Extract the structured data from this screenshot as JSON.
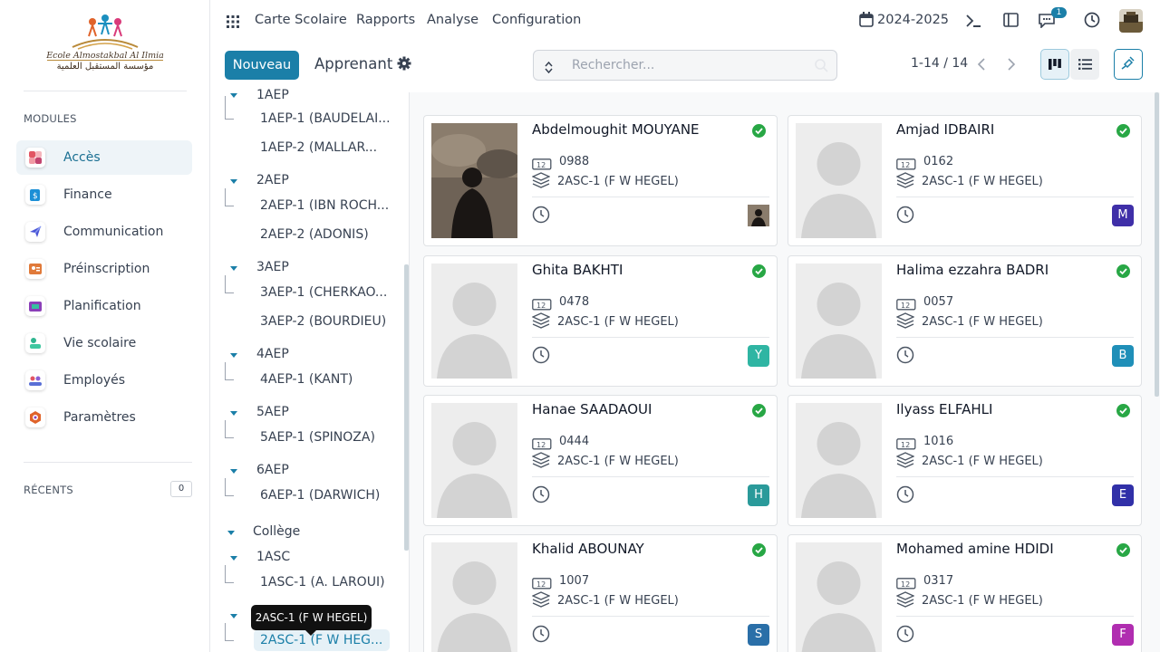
{
  "logo": {
    "line1": "Ecole Almostakbal Al Ilmia",
    "line2": "مؤسسة المستقبل العلمية"
  },
  "sidebar": {
    "modules_heading": "MODULES",
    "modules": [
      {
        "label": "Accès",
        "icon": "access-icon",
        "active": true
      },
      {
        "label": "Finance",
        "icon": "finance-icon"
      },
      {
        "label": "Communication",
        "icon": "communication-icon"
      },
      {
        "label": "Préinscription",
        "icon": "preinscription-icon"
      },
      {
        "label": "Planification",
        "icon": "planification-icon"
      },
      {
        "label": "Vie scolaire",
        "icon": "school-life-icon"
      },
      {
        "label": "Employés",
        "icon": "employees-icon"
      },
      {
        "label": "Paramètres",
        "icon": "settings-icon"
      }
    ],
    "recents_heading": "RÉCENTS",
    "recents_count": "0"
  },
  "topnav": {
    "items": [
      "Carte Scolaire",
      "Rapports",
      "Analyse",
      "Configuration"
    ],
    "year": "2024-2025",
    "chat_badge": "1"
  },
  "controls": {
    "new_label": "Nouveau",
    "title": "Apprenant",
    "search_placeholder": "Rechercher...",
    "pager": "1-14 / 14"
  },
  "tree": {
    "cut_top": "1AEP",
    "leaves_1aep": [
      "1AEP-1 (BAUDELAI...",
      "1AEP-2 (MALLAR..."
    ],
    "levels": [
      "2AEP",
      "3AEP",
      "4AEP",
      "5AEP",
      "6AEP"
    ],
    "leaves": {
      "2AEP": [
        "2AEP-1 (IBN ROCH...",
        "2AEP-2 (ADONIS)"
      ],
      "3AEP": [
        "3AEP-1 (CHERKAO...",
        "3AEP-2 (BOURDIEU)"
      ],
      "4AEP": [
        "4AEP-1 (KANT)"
      ],
      "5AEP": [
        "5AEP-1 (SPINOZA)"
      ],
      "6AEP": [
        "6AEP-1 (DARWICH)"
      ]
    },
    "college": "Collège",
    "asc1": "1ASC",
    "asc1_leaf": "1ASC-1 (A. LAROUI)",
    "tooltip": "2ASC-1 (F W HEGEL)",
    "selected": "2ASC-1 (F W HEG..."
  },
  "students": [
    {
      "name": "Abdelmoughit MOUYANE",
      "id": "0988",
      "class": "2ASC-1 (F W HEGEL)",
      "avatar": "",
      "avatar_color": "#5b4a3a",
      "photo": true
    },
    {
      "name": "Amjad IDBAIRI",
      "id": "0162",
      "class": "2ASC-1 (F W HEGEL)",
      "avatar": "M",
      "avatar_color": "#3f2fa8"
    },
    {
      "name": "Ghita BAKHTI",
      "id": "0478",
      "class": "2ASC-1 (F W HEGEL)",
      "avatar": "Y",
      "avatar_color": "#2fb5a3"
    },
    {
      "name": "Halima ezzahra BADRI",
      "id": "0057",
      "class": "2ASC-1 (F W HEGEL)",
      "avatar": "B",
      "avatar_color": "#1f8fb8"
    },
    {
      "name": "Hanae SAADAOUI",
      "id": "0444",
      "class": "2ASC-1 (F W HEGEL)",
      "avatar": "H",
      "avatar_color": "#2a9a9a"
    },
    {
      "name": "Ilyass ELFAHLI",
      "id": "1016",
      "class": "2ASC-1 (F W HEGEL)",
      "avatar": "E",
      "avatar_color": "#3130a8"
    },
    {
      "name": "Khalid ABOUNAY",
      "id": "1007",
      "class": "2ASC-1 (F W HEGEL)",
      "avatar": "S",
      "avatar_color": "#2a6fa8"
    },
    {
      "name": "Mohamed amine HDIDI",
      "id": "0317",
      "class": "2ASC-1 (F W HEGEL)",
      "avatar": "F",
      "avatar_color": "#b02db0"
    }
  ],
  "colors": {
    "brand": "#1b7fa8",
    "success": "#28a745"
  }
}
